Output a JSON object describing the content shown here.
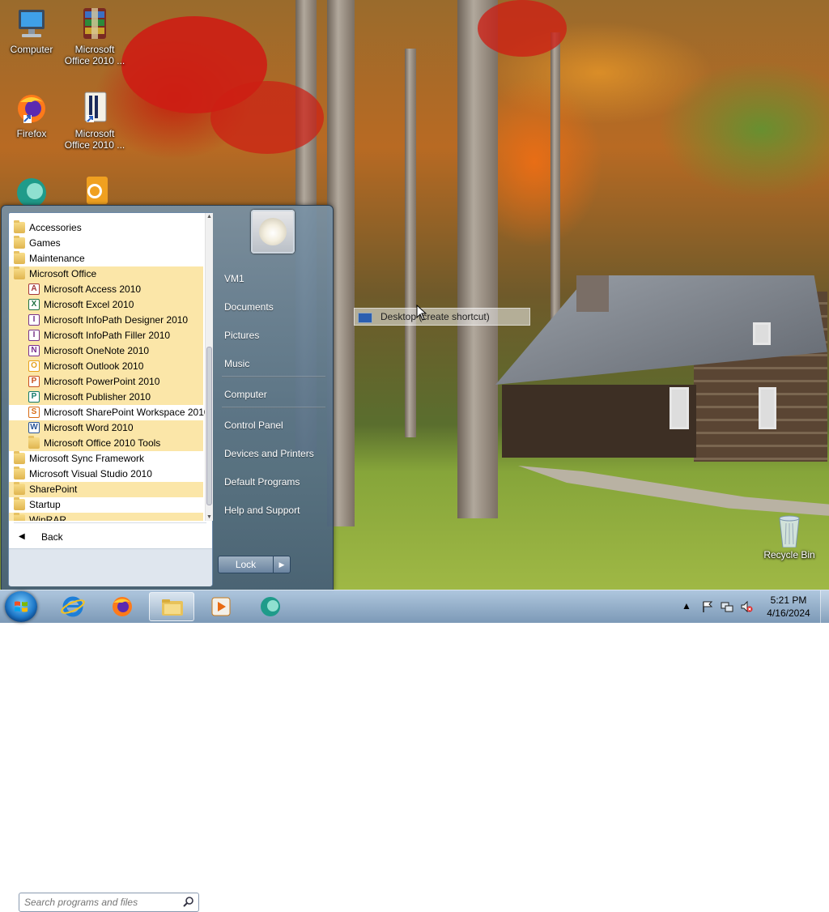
{
  "desktop": {
    "icons": [
      {
        "name": "computer-icon",
        "label": "Computer"
      },
      {
        "name": "office-2010-icon",
        "label": "Microsoft Office 2010 ..."
      },
      {
        "name": "firefox-icon",
        "label": "Firefox"
      },
      {
        "name": "office-2010-icon",
        "label": "Microsoft Office 2010 ..."
      },
      {
        "name": "app-icon",
        "label": ""
      },
      {
        "name": "outlook-icon",
        "label": ""
      },
      {
        "name": "recycle-bin-icon",
        "label": "Recycle Bin"
      }
    ],
    "drag_tooltip": "Desktop (create shortcut)"
  },
  "start_menu": {
    "programs": [
      {
        "label": "Accessories",
        "type": "folder",
        "indent": 0,
        "highlight": false
      },
      {
        "label": "Games",
        "type": "folder",
        "indent": 0,
        "highlight": false
      },
      {
        "label": "Maintenance",
        "type": "folder",
        "indent": 0,
        "highlight": false
      },
      {
        "label": "Microsoft Office",
        "type": "folder",
        "indent": 0,
        "highlight": true
      },
      {
        "label": "Microsoft Access 2010",
        "type": "app",
        "icon": "A",
        "color": "#a4373a",
        "indent": 1,
        "highlight": true
      },
      {
        "label": "Microsoft Excel 2010",
        "type": "app",
        "icon": "X",
        "color": "#1f7244",
        "indent": 1,
        "highlight": true
      },
      {
        "label": "Microsoft InfoPath Designer 2010",
        "type": "app",
        "icon": "I",
        "color": "#77338a",
        "indent": 1,
        "highlight": true
      },
      {
        "label": "Microsoft InfoPath Filler 2010",
        "type": "app",
        "icon": "I",
        "color": "#77338a",
        "indent": 1,
        "highlight": true
      },
      {
        "label": "Microsoft OneNote 2010",
        "type": "app",
        "icon": "N",
        "color": "#7a2f8f",
        "indent": 1,
        "highlight": true
      },
      {
        "label": "Microsoft Outlook 2010",
        "type": "app",
        "icon": "O",
        "color": "#e6a11c",
        "indent": 1,
        "highlight": true
      },
      {
        "label": "Microsoft PowerPoint 2010",
        "type": "app",
        "icon": "P",
        "color": "#c8501e",
        "indent": 1,
        "highlight": true
      },
      {
        "label": "Microsoft Publisher 2010",
        "type": "app",
        "icon": "P",
        "color": "#137a6b",
        "indent": 1,
        "highlight": true
      },
      {
        "label": "Microsoft SharePoint Workspace 2010",
        "type": "app",
        "icon": "S",
        "color": "#d86b12",
        "indent": 1,
        "highlight": false
      },
      {
        "label": "Microsoft Word 2010",
        "type": "app",
        "icon": "W",
        "color": "#2a5699",
        "indent": 1,
        "highlight": true
      },
      {
        "label": "Microsoft Office 2010 Tools",
        "type": "folder",
        "indent": 1,
        "highlight": true
      },
      {
        "label": "Microsoft Sync Framework",
        "type": "folder",
        "indent": 0,
        "highlight": false
      },
      {
        "label": "Microsoft Visual Studio 2010",
        "type": "folder",
        "indent": 0,
        "highlight": false
      },
      {
        "label": "SharePoint",
        "type": "folder",
        "indent": 0,
        "highlight": true
      },
      {
        "label": "Startup",
        "type": "folder",
        "indent": 0,
        "highlight": false
      },
      {
        "label": "WinRAR",
        "type": "folder",
        "indent": 0,
        "highlight": true
      }
    ],
    "back_label": "Back",
    "search_placeholder": "Search programs and files",
    "right_items": [
      {
        "label": "VM1",
        "name": "start-item-vm1"
      },
      {
        "label": "Documents",
        "name": "start-item-documents"
      },
      {
        "label": "Pictures",
        "name": "start-item-pictures"
      },
      {
        "label": "Music",
        "name": "start-item-music"
      },
      {
        "label": "Computer",
        "name": "start-item-computer"
      },
      {
        "label": "Control Panel",
        "name": "start-item-control-panel"
      },
      {
        "label": "Devices and Printers",
        "name": "start-item-devices-printers"
      },
      {
        "label": "Default Programs",
        "name": "start-item-default-programs"
      },
      {
        "label": "Help and Support",
        "name": "start-item-help-support"
      }
    ],
    "lock_label": "Lock"
  },
  "taskbar": {
    "pinned": [
      "internet-explorer-icon",
      "firefox-icon",
      "file-explorer-icon",
      "media-player-icon",
      "app-icon"
    ],
    "clock": {
      "time": "5:21 PM",
      "date": "4/16/2024"
    }
  },
  "colors": {
    "highlight": "#fbe6a8",
    "taskbar": "#9fb8d0",
    "start_menu": "#5f7d99"
  }
}
